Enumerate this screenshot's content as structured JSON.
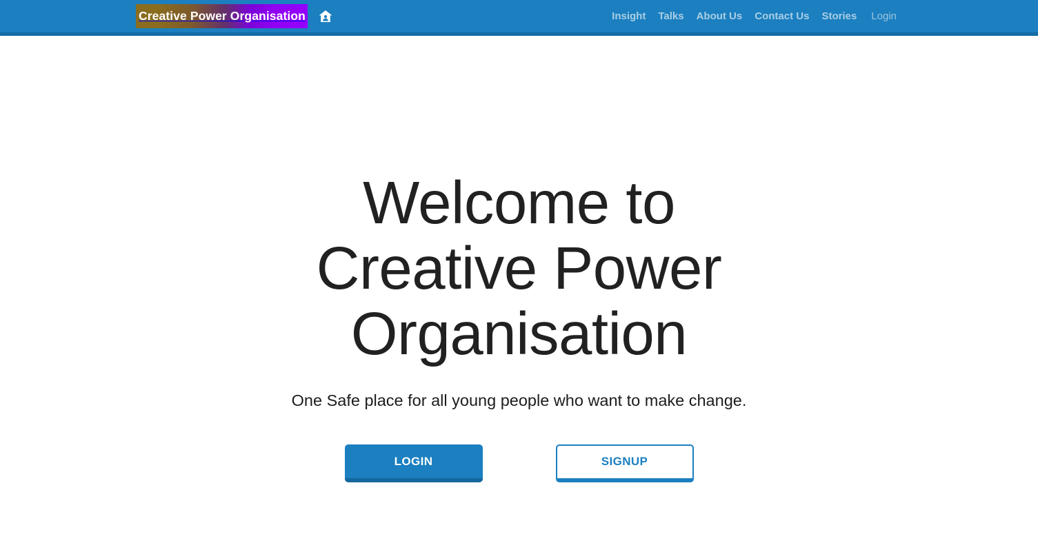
{
  "header": {
    "brand": {
      "text": "Creative Power Organisation",
      "gradient_from": "#8a6d1e",
      "gradient_mid": "#63306b",
      "gradient_to": "#9400ff"
    },
    "home_icon_name": "home-person-icon",
    "background_color": "#1b7fc0",
    "border_color": "#146ba6",
    "nav": [
      {
        "label": "Insight",
        "name": "nav-link-insight",
        "active": true
      },
      {
        "label": "Talks",
        "name": "nav-link-talks",
        "active": true
      },
      {
        "label": "About Us",
        "name": "nav-link-about-us",
        "active": true
      },
      {
        "label": "Contact Us",
        "name": "nav-link-contact-us",
        "active": true
      },
      {
        "label": "Stories",
        "name": "nav-link-stories",
        "active": true
      },
      {
        "label": "Login",
        "name": "nav-link-login",
        "active": false
      }
    ]
  },
  "hero": {
    "title": "Welcome to Creative Power Organisation",
    "subtitle": "One Safe place for all young people who want to make change.",
    "buttons": {
      "login": {
        "label": "LOGIN",
        "background": "#1b7fc0",
        "text_color": "#ffffff",
        "shadow_color": "#14689f"
      },
      "signup": {
        "label": "SIGNUP",
        "background": "#ffffff",
        "text_color": "#1b7fc0",
        "border_color": "#1b7fc0"
      }
    }
  },
  "page": {
    "background": "#ffffff",
    "text_color": "#212121"
  }
}
